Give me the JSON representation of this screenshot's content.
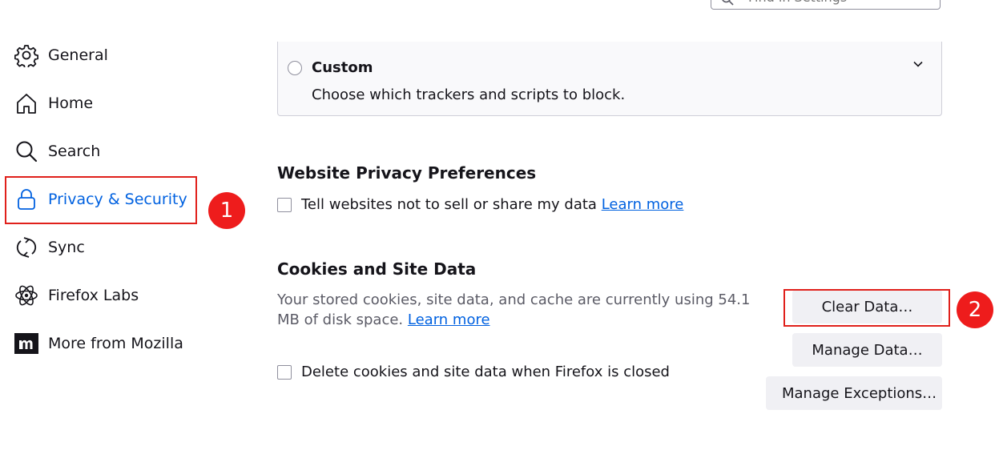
{
  "search": {
    "placeholder": "Find in Settings"
  },
  "sidebar": {
    "items": [
      {
        "label": "General",
        "icon": "gear-icon"
      },
      {
        "label": "Home",
        "icon": "home-icon"
      },
      {
        "label": "Search",
        "icon": "search-icon"
      },
      {
        "label": "Privacy & Security",
        "icon": "lock-icon",
        "active": true
      },
      {
        "label": "Sync",
        "icon": "sync-icon"
      },
      {
        "label": "Firefox Labs",
        "icon": "atom-icon"
      },
      {
        "label": "More from Mozilla",
        "icon": "mozilla-icon"
      }
    ]
  },
  "annotations": {
    "badge1": "1",
    "badge2": "2"
  },
  "custom": {
    "title": "Custom",
    "description": "Choose which trackers and scripts to block."
  },
  "website_privacy": {
    "heading": "Website Privacy Preferences",
    "checkbox_label": "Tell websites not to sell or share my data",
    "learn_more": "Learn more"
  },
  "cookies": {
    "heading": "Cookies and Site Data",
    "description": "Your stored cookies, site data, and cache are currently using 54.1 MB of disk space.",
    "learn_more": "Learn more",
    "clear_button": "Clear Data…",
    "manage_button": "Manage Data…",
    "exceptions_button": "Manage Exceptions…",
    "delete_checkbox_label": "Delete cookies and site data when Firefox is closed"
  },
  "colors": {
    "accent": "#0061e0",
    "annotation": "#e0201b"
  }
}
